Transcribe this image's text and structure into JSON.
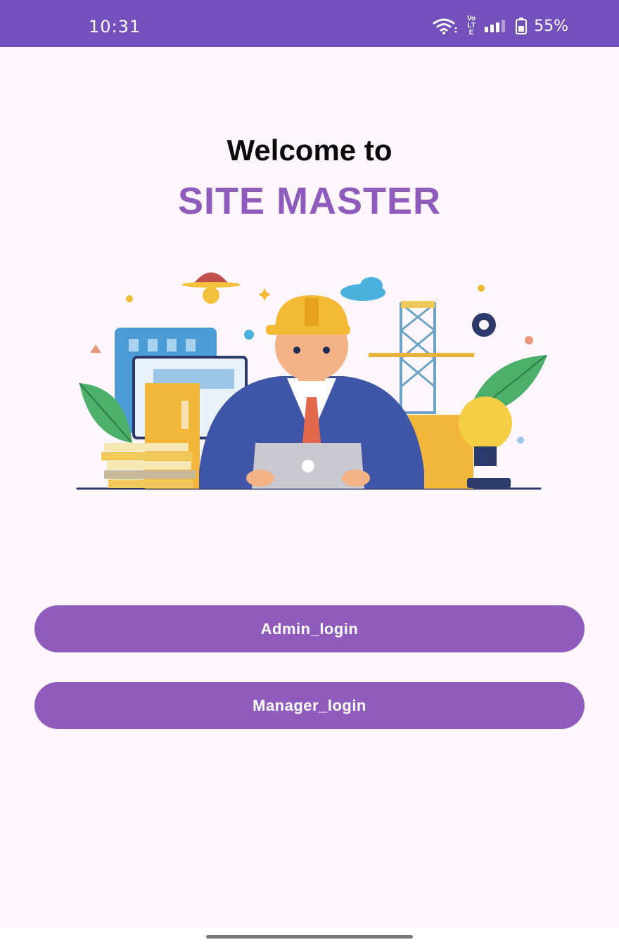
{
  "status_bar": {
    "time": "10:31",
    "network_label": "Vo LTE",
    "battery": "55%"
  },
  "welcome": {
    "line1": "Welcome to",
    "app_name": "SITE MASTER"
  },
  "buttons": {
    "admin_login": "Admin_login",
    "manager_login": "Manager_login"
  },
  "colors": {
    "status_bar": "#7350bb",
    "accent": "#8f5bbd",
    "background": "#fdf6fd"
  }
}
